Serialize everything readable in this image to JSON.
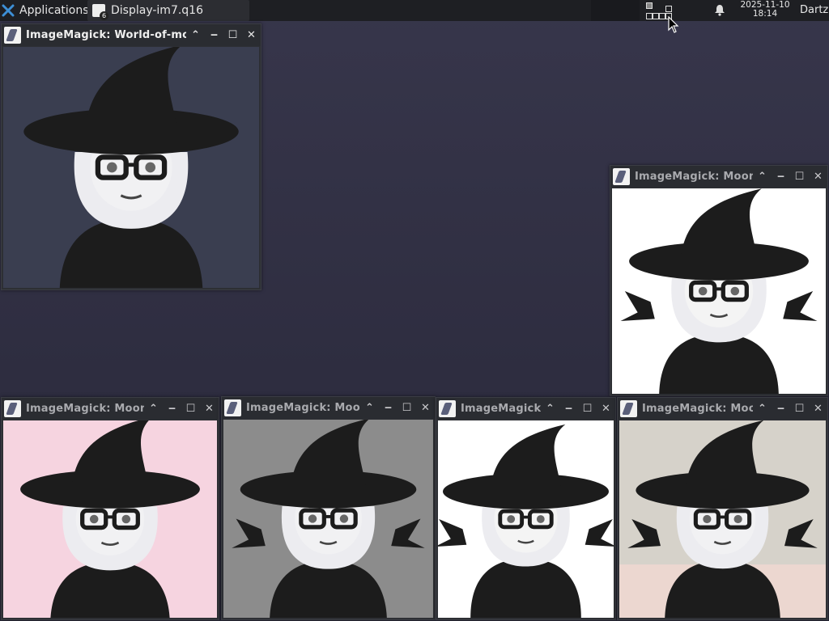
{
  "taskbar": {
    "apps_label": "Applications",
    "active_task": {
      "title": "Display-im7.q16",
      "badge": "6"
    },
    "clock": {
      "date": "2025-11-10",
      "time": "18:14"
    },
    "user": "Dartz"
  },
  "windows": [
    {
      "title": "ImageMagick: World-of-moja",
      "bg": "#3a3e50",
      "theme": "dark"
    },
    {
      "title": "ImageMagick: Moonx",
      "bg": "#ffffff",
      "theme": "mono"
    },
    {
      "title": "ImageMagick: Moonx",
      "bg": "#f6d4e0",
      "theme": "pink"
    },
    {
      "title": "ImageMagick: Moon:",
      "bg": "#8c8c8c",
      "theme": "gray"
    },
    {
      "title": "ImageMagick: I",
      "bg": "#ffffff",
      "theme": "white"
    },
    {
      "title": "ImageMagick: Moon",
      "bg": "#d6d2ca",
      "theme": "beige"
    }
  ],
  "icons": {
    "menu": "menu-icon",
    "close": "close-icon",
    "maximize": "maximize-icon",
    "minimize": "minimize-icon",
    "shade": "chevron-up-icon"
  }
}
